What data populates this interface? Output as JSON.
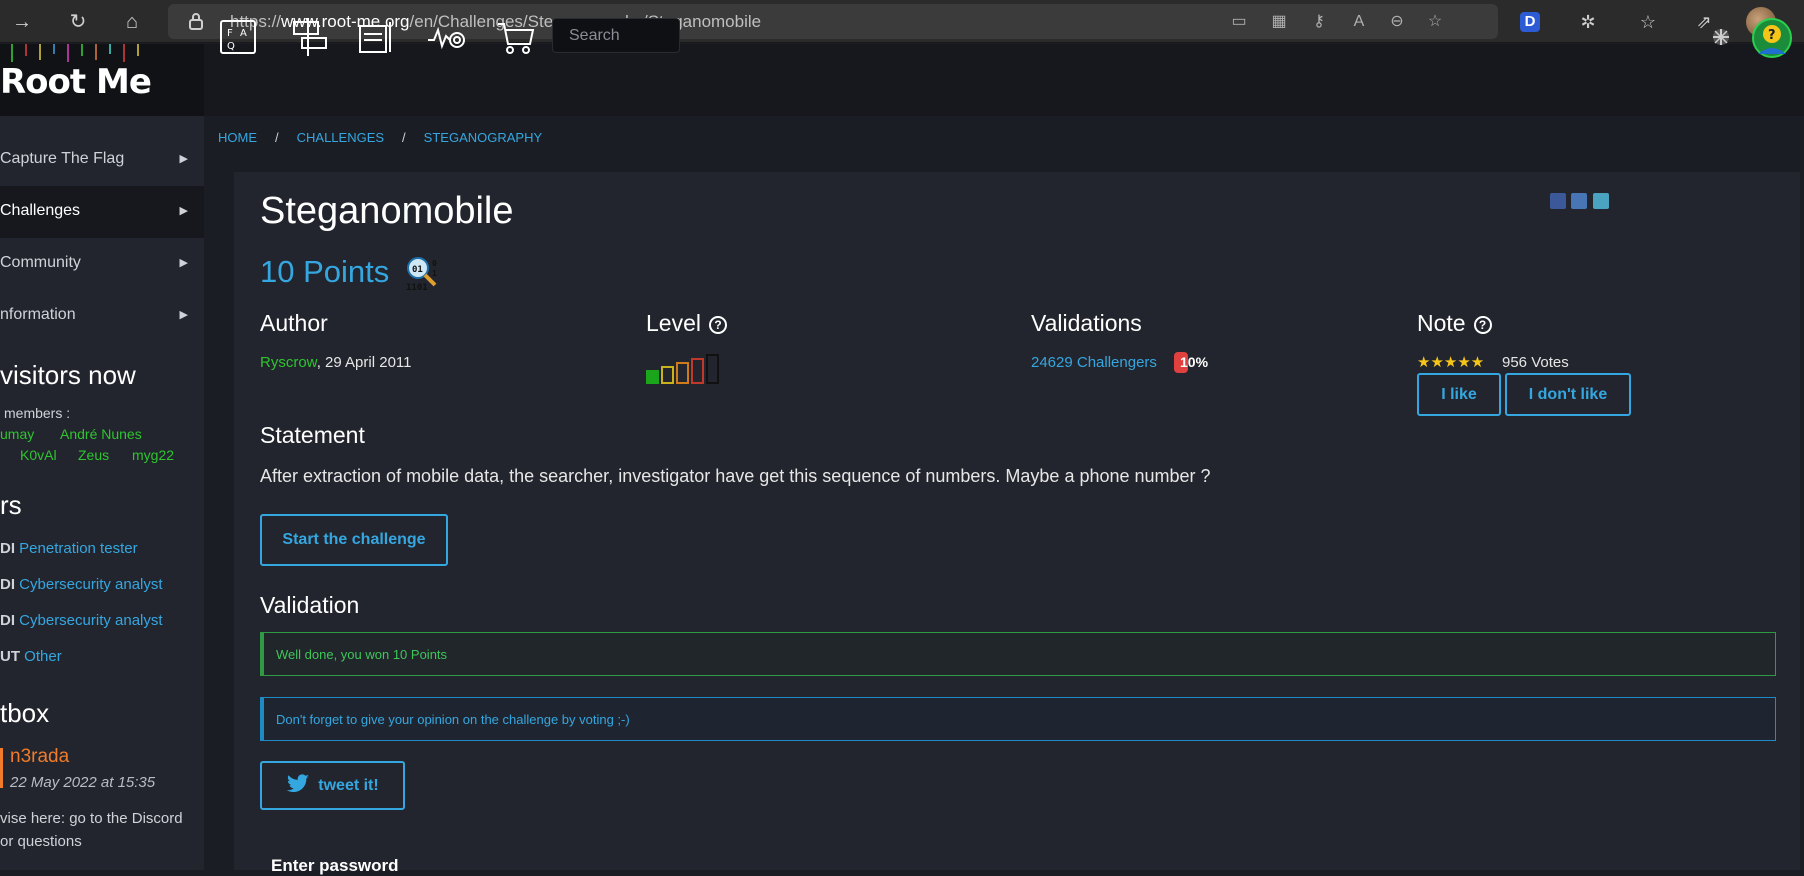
{
  "browser": {
    "url_prefix": "https://",
    "url_host": "www.root-me.org",
    "url_path": "/en/Challenges/Steganography/Steganomobile"
  },
  "site": {
    "logo": "Root Me",
    "search_placeholder": "Search"
  },
  "sidebar": {
    "items": [
      {
        "label": "Capture The Flag"
      },
      {
        "label": "Challenges"
      },
      {
        "label": "Community"
      },
      {
        "label": "nformation"
      }
    ],
    "visitors_heading": "visitors now",
    "members_label": "members :",
    "members_row1": [
      "umay",
      "André Nunes"
    ],
    "members_row2": [
      "K0vAl",
      "Zeus",
      "myg22"
    ],
    "jobs_heading": "rs",
    "jobs": [
      {
        "prefix": "DI",
        "label": "Penetration tester"
      },
      {
        "prefix": "DI",
        "label": "Cybersecurity analyst"
      },
      {
        "prefix": "DI",
        "label": "Cybersecurity analyst"
      },
      {
        "prefix": "UT",
        "label": "Other"
      }
    ],
    "chatbox_heading": "tbox",
    "chat": {
      "name": "n3rada",
      "date": "22 May 2022 at 15:35",
      "line1": "vise here: go to the Discord",
      "line2": "or questions"
    }
  },
  "breadcrumb": {
    "home": "HOME",
    "challenges": "CHALLENGES",
    "category": "STEGANOGRAPHY",
    "sep": "/"
  },
  "challenge": {
    "title": "Steganomobile",
    "points": "10 Points",
    "author_heading": "Author",
    "author_name": "Ryscrow",
    "author_date": ",  29 April 2011",
    "level_heading": "Level",
    "level_value": 1,
    "level_max": 5,
    "validations_heading": "Validations",
    "validations": "24629 Challengers",
    "validation_pct_label": "10%",
    "validation_pct": 10,
    "note_heading": "Note",
    "stars": "★★★★★",
    "votes": "956 Votes",
    "like_label": "I like",
    "dislike_label": "I don't like",
    "statement_heading": "Statement",
    "statement": "After extraction of mobile data, the searcher, investigator have get this sequence of numbers. Maybe a phone number ?",
    "start_label": "Start the challenge",
    "validation_heading": "Validation",
    "success_msg": "Well done, you won 10 Points",
    "info_msg": "Don't forget to give your opinion on the challenge by voting ;-)",
    "tweet_label": "tweet it!",
    "enter_password": "Enter password"
  },
  "colors": {
    "accent": "#35a7e0",
    "success": "#3fc55a",
    "author": "#2ec52e",
    "chat_name": "#f07b2a",
    "badge": "#e0413f"
  }
}
